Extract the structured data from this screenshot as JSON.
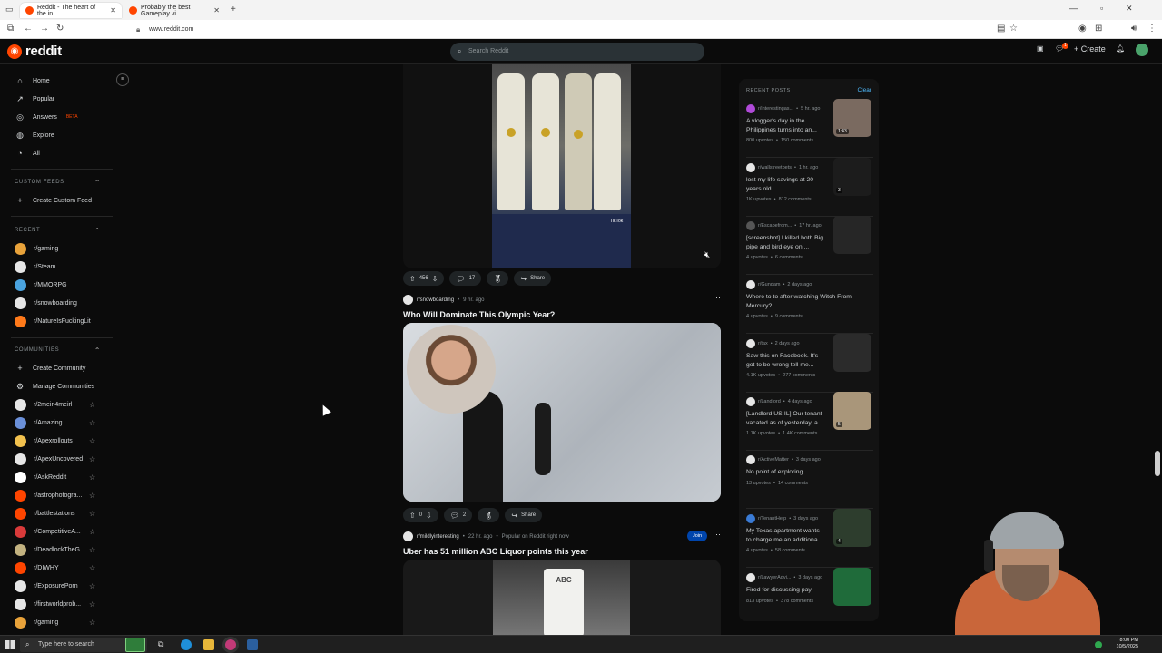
{
  "browser": {
    "tabs": [
      {
        "title": "Reddit - The heart of the in",
        "active": true
      },
      {
        "title": "Probably the best Gameplay vi",
        "active": false
      }
    ],
    "new_tab": "+",
    "url": "www.reddit.com"
  },
  "header": {
    "logo_text": "reddit",
    "search_placeholder": "Search Reddit",
    "create_label": "Create",
    "notif_count": "1"
  },
  "sidebar": {
    "nav": [
      {
        "label": "Home",
        "icon": "home-icon"
      },
      {
        "label": "Popular",
        "icon": "popular-icon"
      },
      {
        "label": "Answers",
        "icon": "answers-icon",
        "badge": "BETA"
      },
      {
        "label": "Explore",
        "icon": "explore-icon"
      },
      {
        "label": "All",
        "icon": "all-icon"
      }
    ],
    "custom_feeds_heading": "CUSTOM FEEDS",
    "create_custom_feed": "Create Custom Feed",
    "recent_heading": "RECENT",
    "recent": [
      {
        "label": "r/gaming",
        "color": "#e8a23a"
      },
      {
        "label": "r/Steam",
        "color": "#e6e6e6"
      },
      {
        "label": "r/MMORPG",
        "color": "#4aa3df"
      },
      {
        "label": "r/snowboarding",
        "color": "#e5e5e5"
      },
      {
        "label": "r/NatureIsFuckingLit",
        "color": "#ff7a1a"
      }
    ],
    "communities_heading": "COMMUNITIES",
    "create_community": "Create Community",
    "manage_communities": "Manage Communities",
    "communities": [
      {
        "label": "r/2meirl4meirl",
        "color": "#e6e6e6"
      },
      {
        "label": "r/Amazing",
        "color": "#6a8fd8"
      },
      {
        "label": "r/Apexrollouts",
        "color": "#f2c14e"
      },
      {
        "label": "r/ApexUncovered",
        "color": "#e6e6e6"
      },
      {
        "label": "r/AskReddit",
        "color": "#ffffff"
      },
      {
        "label": "r/astrophotogra...",
        "color": "#ff4500"
      },
      {
        "label": "r/battlestations",
        "color": "#ff4500"
      },
      {
        "label": "r/CompetitiveA...",
        "color": "#d93a3a"
      },
      {
        "label": "r/DeadlockTheG...",
        "color": "#c2b280"
      },
      {
        "label": "r/DIWHY",
        "color": "#ff4500"
      },
      {
        "label": "r/ExposurePorn",
        "color": "#e6e6e6"
      },
      {
        "label": "r/firstworldprob...",
        "color": "#e6e6e6"
      },
      {
        "label": "r/gaming",
        "color": "#e8a23a"
      }
    ]
  },
  "feed": {
    "post1": {
      "votes": "456",
      "comments": "17",
      "share": "Share",
      "watermark": "TikTok"
    },
    "post2": {
      "subreddit": "r/snowboarding",
      "time": "9 hr. ago",
      "title": "Who Will Dominate This Olympic Year?",
      "votes": "0",
      "comments": "2",
      "share": "Share"
    },
    "post3": {
      "subreddit": "r/mildlyinteresting",
      "time": "22 hr. ago",
      "popular": "Popular on Reddit right now",
      "join": "Join",
      "title": "Uber has 51 million ABC Liquor points this year",
      "receipt": "ABC"
    }
  },
  "recent_posts": {
    "heading": "RECENT POSTS",
    "clear": "Clear",
    "items": [
      {
        "sub": "r/interestingas...",
        "time": "5 hr. ago",
        "title": "A vlogger's day in the Philippines turns into an...",
        "upvotes": "800 upvotes",
        "comments": "150 comments",
        "thumb": "#7a6a60",
        "badge": "1:43",
        "icon_color": "#b04ad8"
      },
      {
        "sub": "r/wallstreetbets",
        "time": "1 hr. ago",
        "title": "lost my life savings at 20 years old",
        "upvotes": "1K upvotes",
        "comments": "812 comments",
        "thumb": "#1c1c1c",
        "badge": "3",
        "icon_color": "#e6e6e6"
      },
      {
        "sub": "r/Escapefrom...",
        "time": "17 hr. ago",
        "title": "[screenshot] I killed both Big pipe and bird eye on ...",
        "upvotes": "4 upvotes",
        "comments": "6 comments",
        "thumb": "#262626",
        "badge": "",
        "icon_color": "#555555"
      },
      {
        "sub": "r/Gundam",
        "time": "2 days ago",
        "title": "Where to to after watching Witch From Mercury?",
        "upvotes": "4 upvotes",
        "comments": "9 comments",
        "thumb": "",
        "badge": "",
        "icon_color": "#e6e6e6"
      },
      {
        "sub": "r/tax",
        "time": "2 days ago",
        "title": "Saw this on Facebook. It's got to be wrong tell me...",
        "upvotes": "4.1K upvotes",
        "comments": "277 comments",
        "thumb": "#2b2b2b",
        "badge": "",
        "icon_color": "#e6e6e6"
      },
      {
        "sub": "r/Landlord",
        "time": "4 days ago",
        "title": "[Landlord US-IL] Our tenant vacated as of yesterday, a...",
        "upvotes": "1.1K upvotes",
        "comments": "1.4K comments",
        "thumb": "#a9967a",
        "badge": "5",
        "icon_color": "#e6e6e6"
      },
      {
        "sub": "r/ActiveMatter",
        "time": "3 days ago",
        "title": "No point of exploring.",
        "upvotes": "13 upvotes",
        "comments": "14 comments",
        "thumb": "",
        "badge": "",
        "icon_color": "#e6e6e6"
      },
      {
        "sub": "r/TenantHelp",
        "time": "3 days ago",
        "title": "My Texas apartment wants to charge me an additiona...",
        "upvotes": "4 upvotes",
        "comments": "58 comments",
        "thumb": "#2d3d2d",
        "badge": "4",
        "icon_color": "#3a7bd5"
      },
      {
        "sub": "r/LawyerAdvi...",
        "time": "3 days ago",
        "title": "Fired for discussing pay",
        "upvotes": "813 upvotes",
        "comments": "378 comments",
        "thumb": "#1f6b3a",
        "badge": "",
        "icon_color": "#e6e6e6"
      }
    ]
  },
  "taskbar": {
    "search_placeholder": "Type here to search",
    "time": "8:00 PM",
    "date": "10/5/2025"
  }
}
